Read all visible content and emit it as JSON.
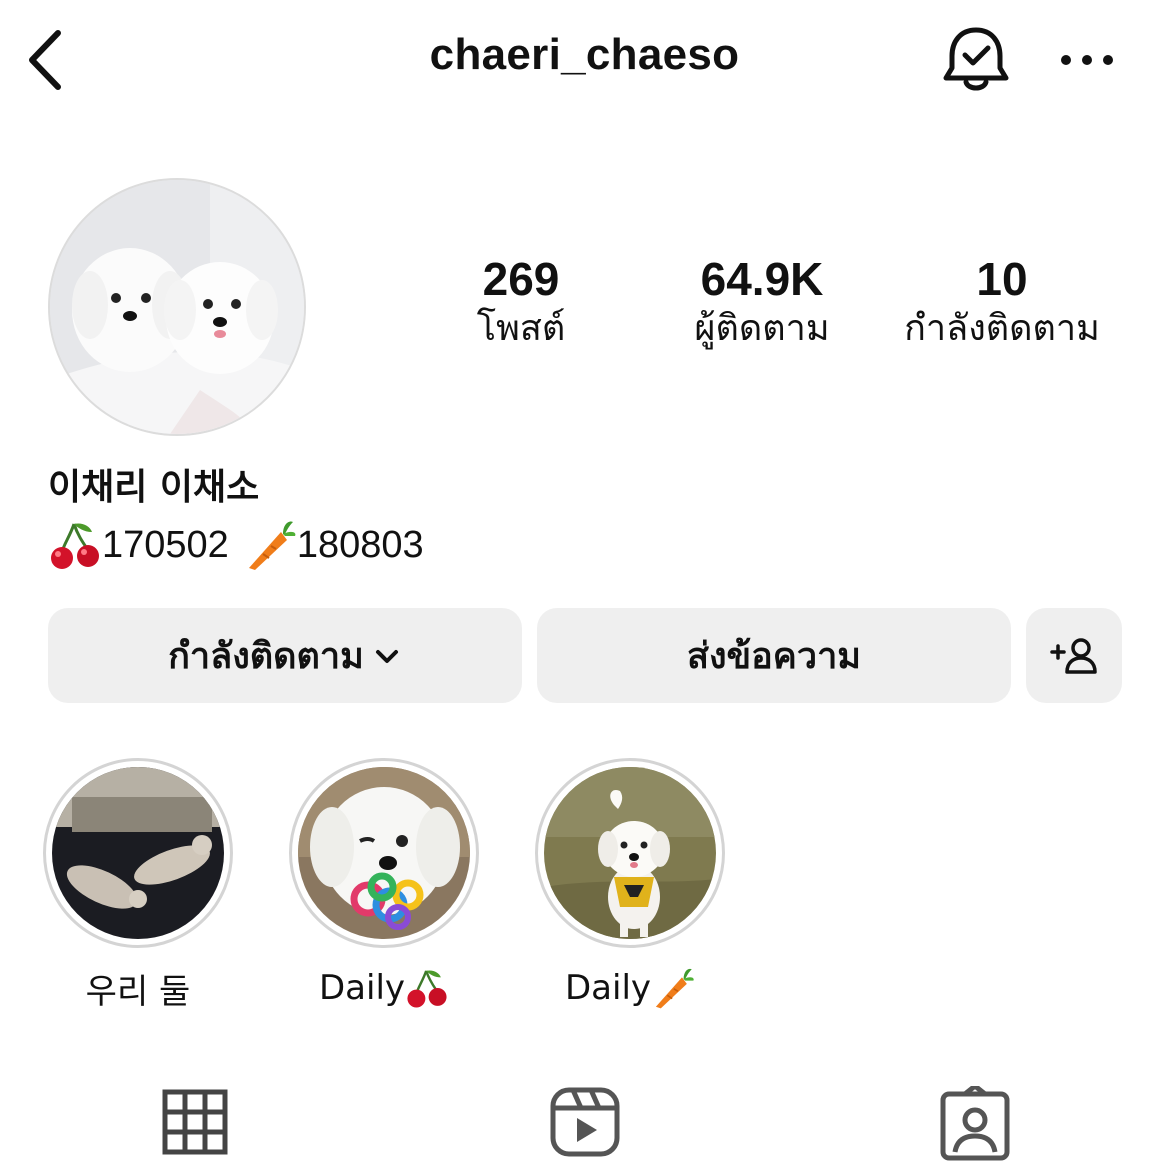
{
  "header": {
    "username": "chaeri_chaeso"
  },
  "stats": {
    "posts": {
      "value": "269",
      "label": "โพสต์"
    },
    "followers": {
      "value": "64.9K",
      "label": "ผู้ติดตาม"
    },
    "following": {
      "value": "10",
      "label": "กำลังติดตาม"
    }
  },
  "bio": {
    "display_name": "이채리 이채소",
    "date1": "170502",
    "date2": "180803",
    "emoji1": "cherry-icon",
    "emoji2": "carrot-icon"
  },
  "buttons": {
    "following": "กำลังติดตาม",
    "message": "ส่งข้อความ"
  },
  "highlights": [
    {
      "label": "우리 둘",
      "emoji": ""
    },
    {
      "label": "Daily",
      "emoji": "cherry-icon"
    },
    {
      "label": "Daily",
      "emoji": "carrot-icon"
    }
  ],
  "colors": {
    "button_bg": "#efefef",
    "text": "#111111",
    "highlight_ring": "#d4d4d4"
  },
  "icons": [
    "back-chevron-icon",
    "bell-check-icon",
    "more-icon",
    "chevron-down-icon",
    "add-user-icon",
    "grid-icon",
    "reels-icon",
    "tagged-icon"
  ]
}
